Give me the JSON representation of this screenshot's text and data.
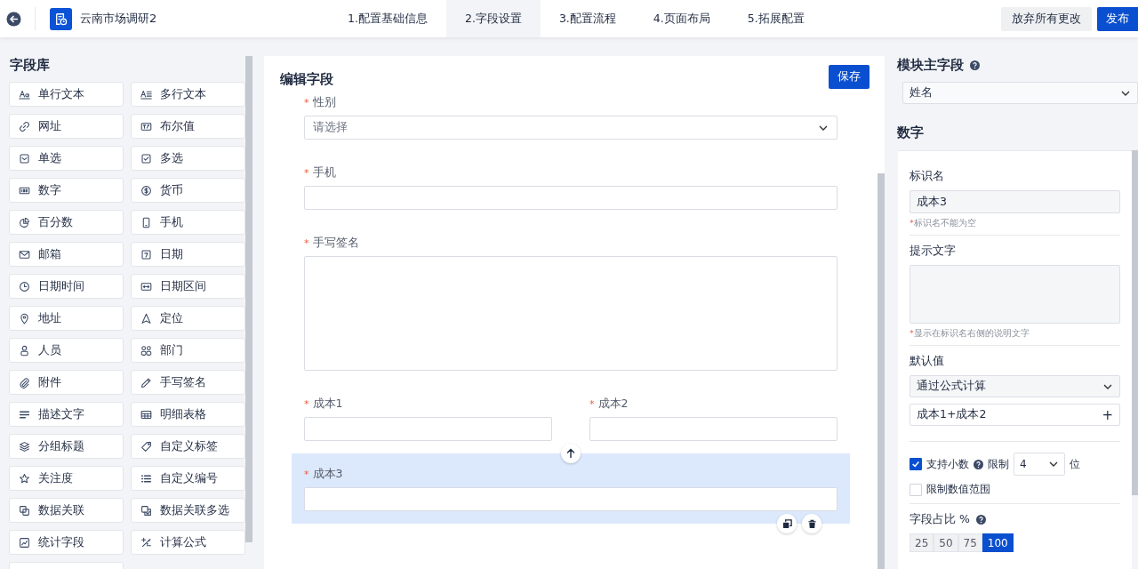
{
  "header": {
    "title": "云南市场调研2",
    "steps": [
      {
        "label": "1.配置基础信息",
        "selected": false
      },
      {
        "label": "2.字段设置",
        "selected": true
      },
      {
        "label": "3.配置流程",
        "selected": false
      },
      {
        "label": "4.页面布局",
        "selected": false
      },
      {
        "label": "5.拓展配置",
        "selected": false
      }
    ],
    "discard_button": "放弃所有更改",
    "publish_button": "发布"
  },
  "library": {
    "title": "字段库",
    "items": [
      "单行文本",
      "多行文本",
      "网址",
      "布尔值",
      "单选",
      "多选",
      "数字",
      "货币",
      "百分数",
      "手机",
      "邮箱",
      "日期",
      "日期时间",
      "日期区间",
      "地址",
      "定位",
      "人员",
      "部门",
      "附件",
      "手写签名",
      "描述文字",
      "明细表格",
      "分组标题",
      "自定义标签",
      "关注度",
      "自定义编号",
      "数据关联",
      "数据关联多选",
      "统计字段",
      "计算公式"
    ]
  },
  "editor": {
    "title": "编辑字段",
    "save_button": "保存",
    "rows": [
      {
        "fields": [
          {
            "kind": "select",
            "label": "性别",
            "mark": "*",
            "placeholder": "请选择",
            "selected": false
          }
        ]
      },
      {
        "fields": [
          {
            "kind": "input",
            "label": "手机",
            "mark": "*",
            "selected": false
          }
        ]
      },
      {
        "fields": [
          {
            "kind": "textarea",
            "label": "手写签名",
            "mark": "*",
            "selected": false
          }
        ]
      },
      {
        "fields": [
          {
            "kind": "input",
            "label": "成本1",
            "mark": "*",
            "selected": false
          },
          {
            "kind": "input",
            "label": "成本2",
            "mark": "*",
            "selected": false
          }
        ]
      },
      {
        "fields": [
          {
            "kind": "input",
            "label": "成本3",
            "mark": "*",
            "selected": true
          }
        ]
      }
    ]
  },
  "properties": {
    "main_field_title": "模块主字段",
    "main_field_value": "姓名",
    "section_title": "数字",
    "name_label": "标识名",
    "name_value": "成本3",
    "name_hint": {
      "mark": "*",
      "text": "标识名不能为空"
    },
    "tip_label": "提示文字",
    "tip_hint": {
      "mark": "*",
      "text": "显示在标识名右侧的说明文字"
    },
    "default_label": "默认值",
    "default_mode": "通过公式计算",
    "formula": "成本1+成本2",
    "formula_add": "+",
    "decimal": {
      "label": "支持小数",
      "checked": true,
      "limit_label": "限制",
      "limit_value": "4",
      "unit": "位"
    },
    "range": {
      "label": "限制数值范围",
      "checked": false
    },
    "width_label": "字段占比 %",
    "widths": [
      {
        "label": "25",
        "selected": false
      },
      {
        "label": "50",
        "selected": false
      },
      {
        "label": "75",
        "selected": false
      },
      {
        "label": "100",
        "selected": true
      }
    ]
  }
}
